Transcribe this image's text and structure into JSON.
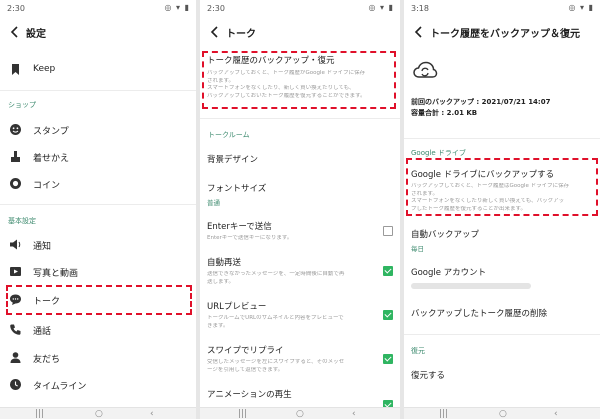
{
  "colors": {
    "accent_green": "#3c8a6e",
    "checkbox_green": "#2fb561",
    "highlight_red": "#e0102a"
  },
  "panel1": {
    "status_time": "2:30",
    "title": "設定",
    "top_item": {
      "label": "Keep",
      "icon": "bookmark-icon"
    },
    "section_shop": "ショップ",
    "shop_items": [
      {
        "label": "スタンプ",
        "icon": "smiley-icon"
      },
      {
        "label": "着せかえ",
        "icon": "brush-icon"
      },
      {
        "label": "コイン",
        "icon": "coin-icon"
      }
    ],
    "section_basic": "基本設定",
    "basic_items": [
      {
        "label": "通知",
        "icon": "speaker-icon"
      },
      {
        "label": "写真と動画",
        "icon": "media-icon"
      },
      {
        "label": "トーク",
        "icon": "chat-bubble-icon"
      },
      {
        "label": "通話",
        "icon": "phone-icon"
      },
      {
        "label": "友だち",
        "icon": "person-icon"
      },
      {
        "label": "タイムライン",
        "icon": "clock-icon"
      }
    ]
  },
  "panel2": {
    "status_time": "2:30",
    "title": "トーク",
    "backup": {
      "title": "トーク履歴のバックアップ・復元",
      "desc": [
        "バックアップしておくと、トーク履歴がGoogle ドライブに保存",
        "されます。",
        "スマートフォンをなくしたり、新しく買い換えたりしても、",
        "バックアップしておいたトーク履歴を復元することができます。"
      ]
    },
    "section_talkroom": "トークルーム",
    "background": "背景デザイン",
    "font_size": {
      "title": "フォントサイズ",
      "value": "普通"
    },
    "enter_send": {
      "title": "Enterキーで送信",
      "desc": "Enterキーで送信キーになります。",
      "checked": false
    },
    "auto_resend": {
      "title": "自動再送",
      "desc": [
        "送信できなかったメッセージを、一定時間後に自動で再",
        "送します。"
      ],
      "checked": true
    },
    "url_preview": {
      "title": "URLプレビュー",
      "desc": [
        "トークルームでURLのサムネイルと内容をプレビューで",
        "きます。"
      ],
      "checked": true
    },
    "swipe_reply": {
      "title": "スワイプでリプライ",
      "desc": [
        "受信したメッセージを左にスワイプすると、そのメッセ",
        "ージを引用して返信できます。"
      ],
      "checked": true
    },
    "animation": {
      "title": "アニメーションの再生",
      "checked": true
    }
  },
  "panel3": {
    "status_time": "3:18",
    "title": "トーク履歴をバックアップ＆復元",
    "last_backup": "前回のバックアップ : 2021/07/21 14:07",
    "total_size": "容量合計 : 2.01 KB",
    "section_google": "Google ドライブ",
    "backup_to_drive": {
      "title": "Google ドライブにバックアップする",
      "desc": [
        "バックアップしておくと、トーク履歴はGoogle ドライブに保存",
        "されます。",
        "スマートフォンをなくしたり新しく買い換えても、バックアッ",
        "プしたトーク履歴を復元することが出来ます。"
      ]
    },
    "auto_backup": {
      "title": "自動バックアップ",
      "value": "毎日"
    },
    "google_account": "Google アカウント",
    "delete_backup": "バックアップしたトーク履歴の削除",
    "section_restore": "復元",
    "restore": "復元する"
  }
}
